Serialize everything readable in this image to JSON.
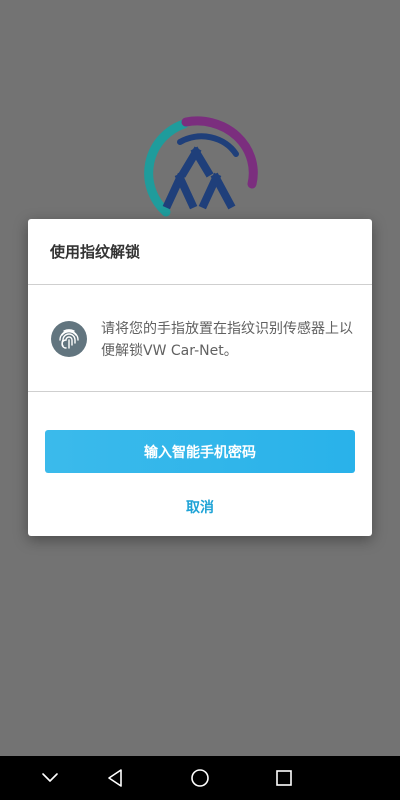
{
  "dialog": {
    "title": "使用指纹解锁",
    "icon": "fingerprint-icon",
    "message": "请将您的手指放置在指纹识别传感器上以便解锁VW Car-Net。",
    "primary_button": "输入智能手机密码",
    "cancel_button": "取消"
  },
  "app": {
    "logo": "vw-car-net-logo"
  },
  "nav_bar": {
    "icons": [
      "chevron-down-icon",
      "back-triangle-icon",
      "home-circle-icon",
      "recents-square-icon"
    ]
  },
  "colors": {
    "scrim": "#737373",
    "accent": "#29b2ea",
    "cancel_text": "#1ea3d6",
    "icon_bg": "#62757f"
  }
}
